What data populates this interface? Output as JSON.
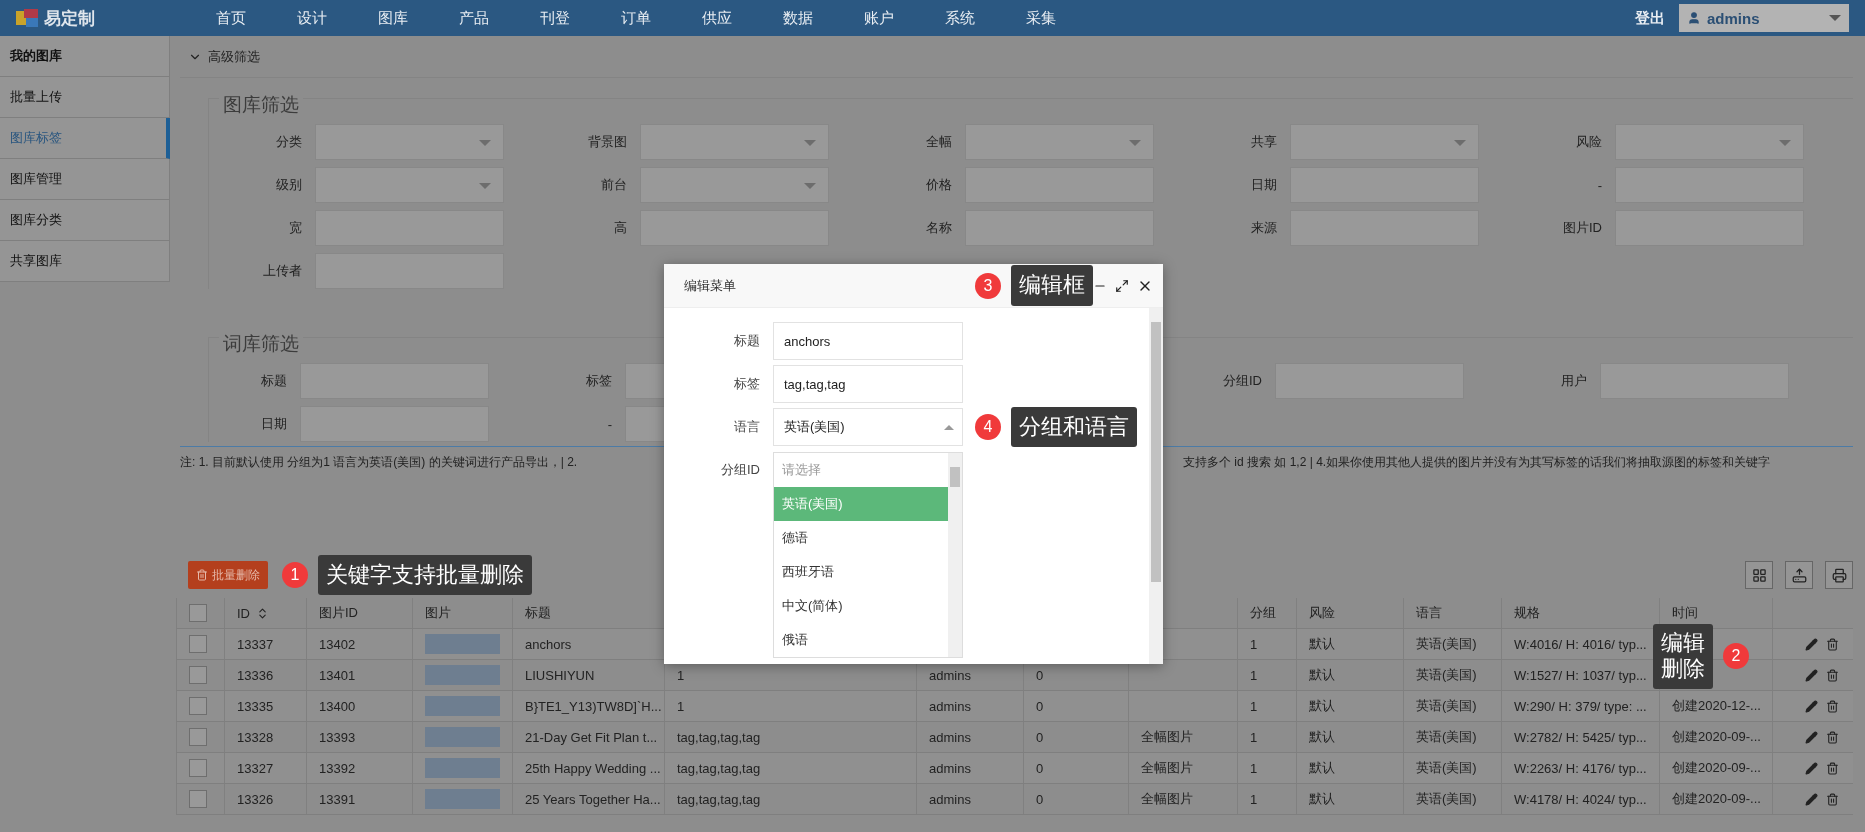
{
  "nav": {
    "logo": "易定制",
    "items": [
      "首页",
      "设计",
      "图库",
      "产品",
      "刊登",
      "订单",
      "供应",
      "数据",
      "账户",
      "系统",
      "采集"
    ],
    "logout": "登出",
    "user": "admins"
  },
  "sidebar": {
    "items": [
      {
        "label": "我的图库",
        "kind": "heading",
        "selected": false
      },
      {
        "label": "批量上传",
        "kind": "link",
        "selected": false
      },
      {
        "label": "图库标签",
        "kind": "link",
        "selected": true
      },
      {
        "label": "图库管理",
        "kind": "link",
        "selected": false
      },
      {
        "label": "图库分类",
        "kind": "link",
        "selected": false
      },
      {
        "label": "共享图库",
        "kind": "link",
        "selected": false
      }
    ]
  },
  "filter": {
    "toggle": "高级筛选",
    "expanded": true,
    "gallery": {
      "title": "图库筛选",
      "fields": [
        {
          "label": "分类",
          "kind": "select"
        },
        {
          "label": "背景图",
          "kind": "select"
        },
        {
          "label": "全幅",
          "kind": "select"
        },
        {
          "label": "共享",
          "kind": "select"
        },
        {
          "label": "风险",
          "kind": "select"
        },
        {
          "label": "级别",
          "kind": "select"
        },
        {
          "label": "前台",
          "kind": "select"
        },
        {
          "label": "价格",
          "kind": "text"
        },
        {
          "label": "日期",
          "kind": "text"
        },
        {
          "label": "-",
          "kind": "text"
        },
        {
          "label": "宽",
          "kind": "text"
        },
        {
          "label": "高",
          "kind": "text"
        },
        {
          "label": "名称",
          "kind": "text"
        },
        {
          "label": "来源",
          "kind": "text"
        },
        {
          "label": "图片ID",
          "kind": "text"
        },
        {
          "label": "上传者",
          "kind": "text"
        }
      ]
    },
    "words": {
      "title": "词库筛选",
      "rows": [
        {
          "left": [
            {
              "label": "标题",
              "kind": "text"
            },
            {
              "label": "标签",
              "kind": "text"
            }
          ],
          "right": [
            {
              "label": "分组ID",
              "kind": "text"
            },
            {
              "label": "用户",
              "kind": "text"
            }
          ]
        },
        {
          "left": [
            {
              "label": "日期",
              "kind": "text"
            },
            {
              "label": "-",
              "kind": "text"
            }
          ],
          "right": []
        }
      ]
    }
  },
  "note": {
    "left": "注: 1. 目前默认使用 分组为1 语言为英语(美国) 的关键词进行产品导出，| 2.",
    "right": "支持多个 id 搜索 如 1,2 | 4.如果你使用其他人提供的图片并没有为其写标签的话我们将抽取源图的标签和关键字"
  },
  "table": {
    "bulk_delete": "批量删除",
    "callout": {
      "number": "1",
      "text": "关键字支持批量删除"
    },
    "row_callout": {
      "number": "2",
      "lines": [
        "编辑",
        "删除"
      ]
    },
    "select_all": {
      "checked": false
    },
    "columns": [
      {
        "label": "ID",
        "sortable": true
      },
      {
        "label": "图片ID",
        "sortable": false
      },
      {
        "label": "图片",
        "sortable": false
      },
      {
        "label": "标题",
        "sortable": false
      },
      {
        "label": "分组",
        "sortable": false
      },
      {
        "label": "风险",
        "sortable": false
      },
      {
        "label": "语言",
        "sortable": false
      },
      {
        "label": "规格",
        "sortable": false
      },
      {
        "label": "时间",
        "sortable": false
      }
    ],
    "rows": [
      {
        "checked": false,
        "id": "13337",
        "image_id": "13402",
        "title": "anchors",
        "group": "1",
        "risk": "默认",
        "language": "英语(美国)",
        "spec": "W:4016/ H: 4016/ typ..."
      },
      {
        "checked": false,
        "id": "13336",
        "image_id": "13401",
        "title": "LIUSHIYUN",
        "column_5": "1",
        "column_6": "admins",
        "column_7": "0",
        "group": "1",
        "risk": "默认",
        "language": "英语(美国)",
        "spec": "W:1527/ H: 1037/ typ..."
      },
      {
        "checked": false,
        "id": "13335",
        "image_id": "13400",
        "title": "B}TE1_Y13)TW8D]`H...",
        "column_5": "1",
        "column_6": "admins",
        "column_7": "0",
        "group": "1",
        "risk": "默认",
        "language": "英语(美国)",
        "spec": "W:290/ H: 379/ type: ...",
        "time": "创建2020-12-..."
      },
      {
        "checked": false,
        "id": "13328",
        "image_id": "13393",
        "title": "21-Day Get Fit Plan t...",
        "column_5": "tag,tag,tag,tag",
        "column_6": "admins",
        "column_7": "0",
        "column_8": "全幅图片",
        "group": "1",
        "risk": "默认",
        "language": "英语(美国)",
        "spec": "W:2782/ H: 5425/ typ...",
        "time": "创建2020-09-..."
      },
      {
        "checked": false,
        "id": "13327",
        "image_id": "13392",
        "title": "25th Happy Wedding ...",
        "column_5": "tag,tag,tag,tag",
        "column_6": "admins",
        "column_7": "0",
        "column_8": "全幅图片",
        "group": "1",
        "risk": "默认",
        "language": "英语(美国)",
        "spec": "W:2263/ H: 4176/ typ...",
        "time": "创建2020-09-..."
      },
      {
        "checked": false,
        "id": "13326",
        "image_id": "13391",
        "title": "25 Years Together Ha...",
        "column_5": "tag,tag,tag,tag",
        "column_6": "admins",
        "column_7": "0",
        "column_8": "全幅图片",
        "group": "1",
        "risk": "默认",
        "language": "英语(美国)",
        "spec": "W:4178/ H: 4024/ typ...",
        "time": "创建2020-09-..."
      }
    ]
  },
  "modal": {
    "title": "编辑菜单",
    "callout": {
      "number": "3",
      "text": "编辑框"
    },
    "fields": [
      {
        "label": "标题",
        "kind": "text",
        "value": "anchors"
      },
      {
        "label": "标签",
        "kind": "text",
        "value": "tag,tag,tag"
      },
      {
        "label": "语言",
        "kind": "select",
        "value": "英语(美国)",
        "expanded": true,
        "callout": {
          "number": "4",
          "text": "分组和语言"
        },
        "placeholder": "请选择",
        "options": [
          {
            "label": "英语(美国)",
            "selected": true
          },
          {
            "label": "德语",
            "selected": false
          },
          {
            "label": "西班牙语",
            "selected": false
          },
          {
            "label": "中文(简体)",
            "selected": false
          },
          {
            "label": "俄语",
            "selected": false
          }
        ]
      },
      {
        "label": "分组ID",
        "kind": "label"
      }
    ]
  }
}
